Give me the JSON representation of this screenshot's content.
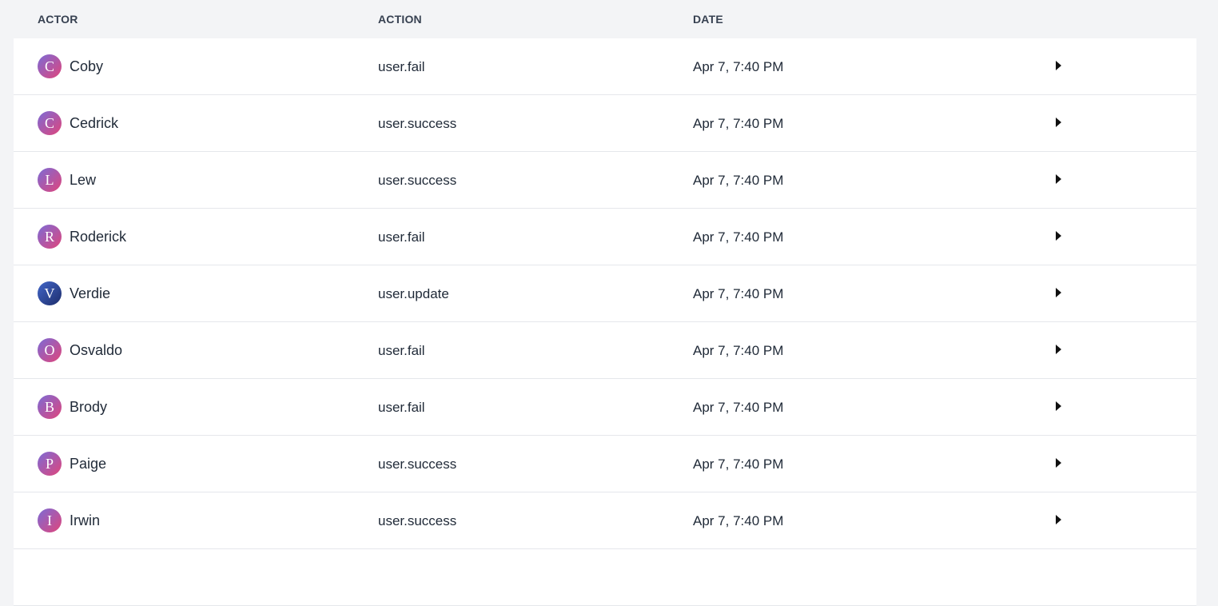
{
  "columns": {
    "actor": "ACTOR",
    "action": "ACTION",
    "date": "DATE"
  },
  "avatar_gradients": {
    "pink_purple": [
      "#7c6bd6",
      "#e0457b"
    ],
    "blue_navy": [
      "#4266c9",
      "#1d2d6b"
    ]
  },
  "rows": [
    {
      "initial": "C",
      "actor": "Coby",
      "action": "user.fail",
      "date": "Apr 7, 7:40 PM",
      "avatar": "pink_purple",
      "icon": "caret-right-icon"
    },
    {
      "initial": "C",
      "actor": "Cedrick",
      "action": "user.success",
      "date": "Apr 7, 7:40 PM",
      "avatar": "pink_purple",
      "icon": "caret-right-icon"
    },
    {
      "initial": "L",
      "actor": "Lew",
      "action": "user.success",
      "date": "Apr 7, 7:40 PM",
      "avatar": "pink_purple",
      "icon": "caret-right-icon"
    },
    {
      "initial": "R",
      "actor": "Roderick",
      "action": "user.fail",
      "date": "Apr 7, 7:40 PM",
      "avatar": "pink_purple",
      "icon": "caret-right-icon"
    },
    {
      "initial": "V",
      "actor": "Verdie",
      "action": "user.update",
      "date": "Apr 7, 7:40 PM",
      "avatar": "blue_navy",
      "icon": "caret-right-icon"
    },
    {
      "initial": "O",
      "actor": "Osvaldo",
      "action": "user.fail",
      "date": "Apr 7, 7:40 PM",
      "avatar": "pink_purple",
      "icon": "caret-right-icon"
    },
    {
      "initial": "B",
      "actor": "Brody",
      "action": "user.fail",
      "date": "Apr 7, 7:40 PM",
      "avatar": "pink_purple",
      "icon": "caret-right-icon"
    },
    {
      "initial": "P",
      "actor": "Paige",
      "action": "user.success",
      "date": "Apr 7, 7:40 PM",
      "avatar": "pink_purple",
      "icon": "caret-right-icon"
    },
    {
      "initial": "I",
      "actor": "Irwin",
      "action": "user.success",
      "date": "Apr 7, 7:40 PM",
      "avatar": "pink_purple",
      "icon": "caret-right-icon"
    },
    {
      "initial": "",
      "actor": "",
      "action": "",
      "date": "",
      "avatar": "pink_purple",
      "icon": ""
    }
  ]
}
